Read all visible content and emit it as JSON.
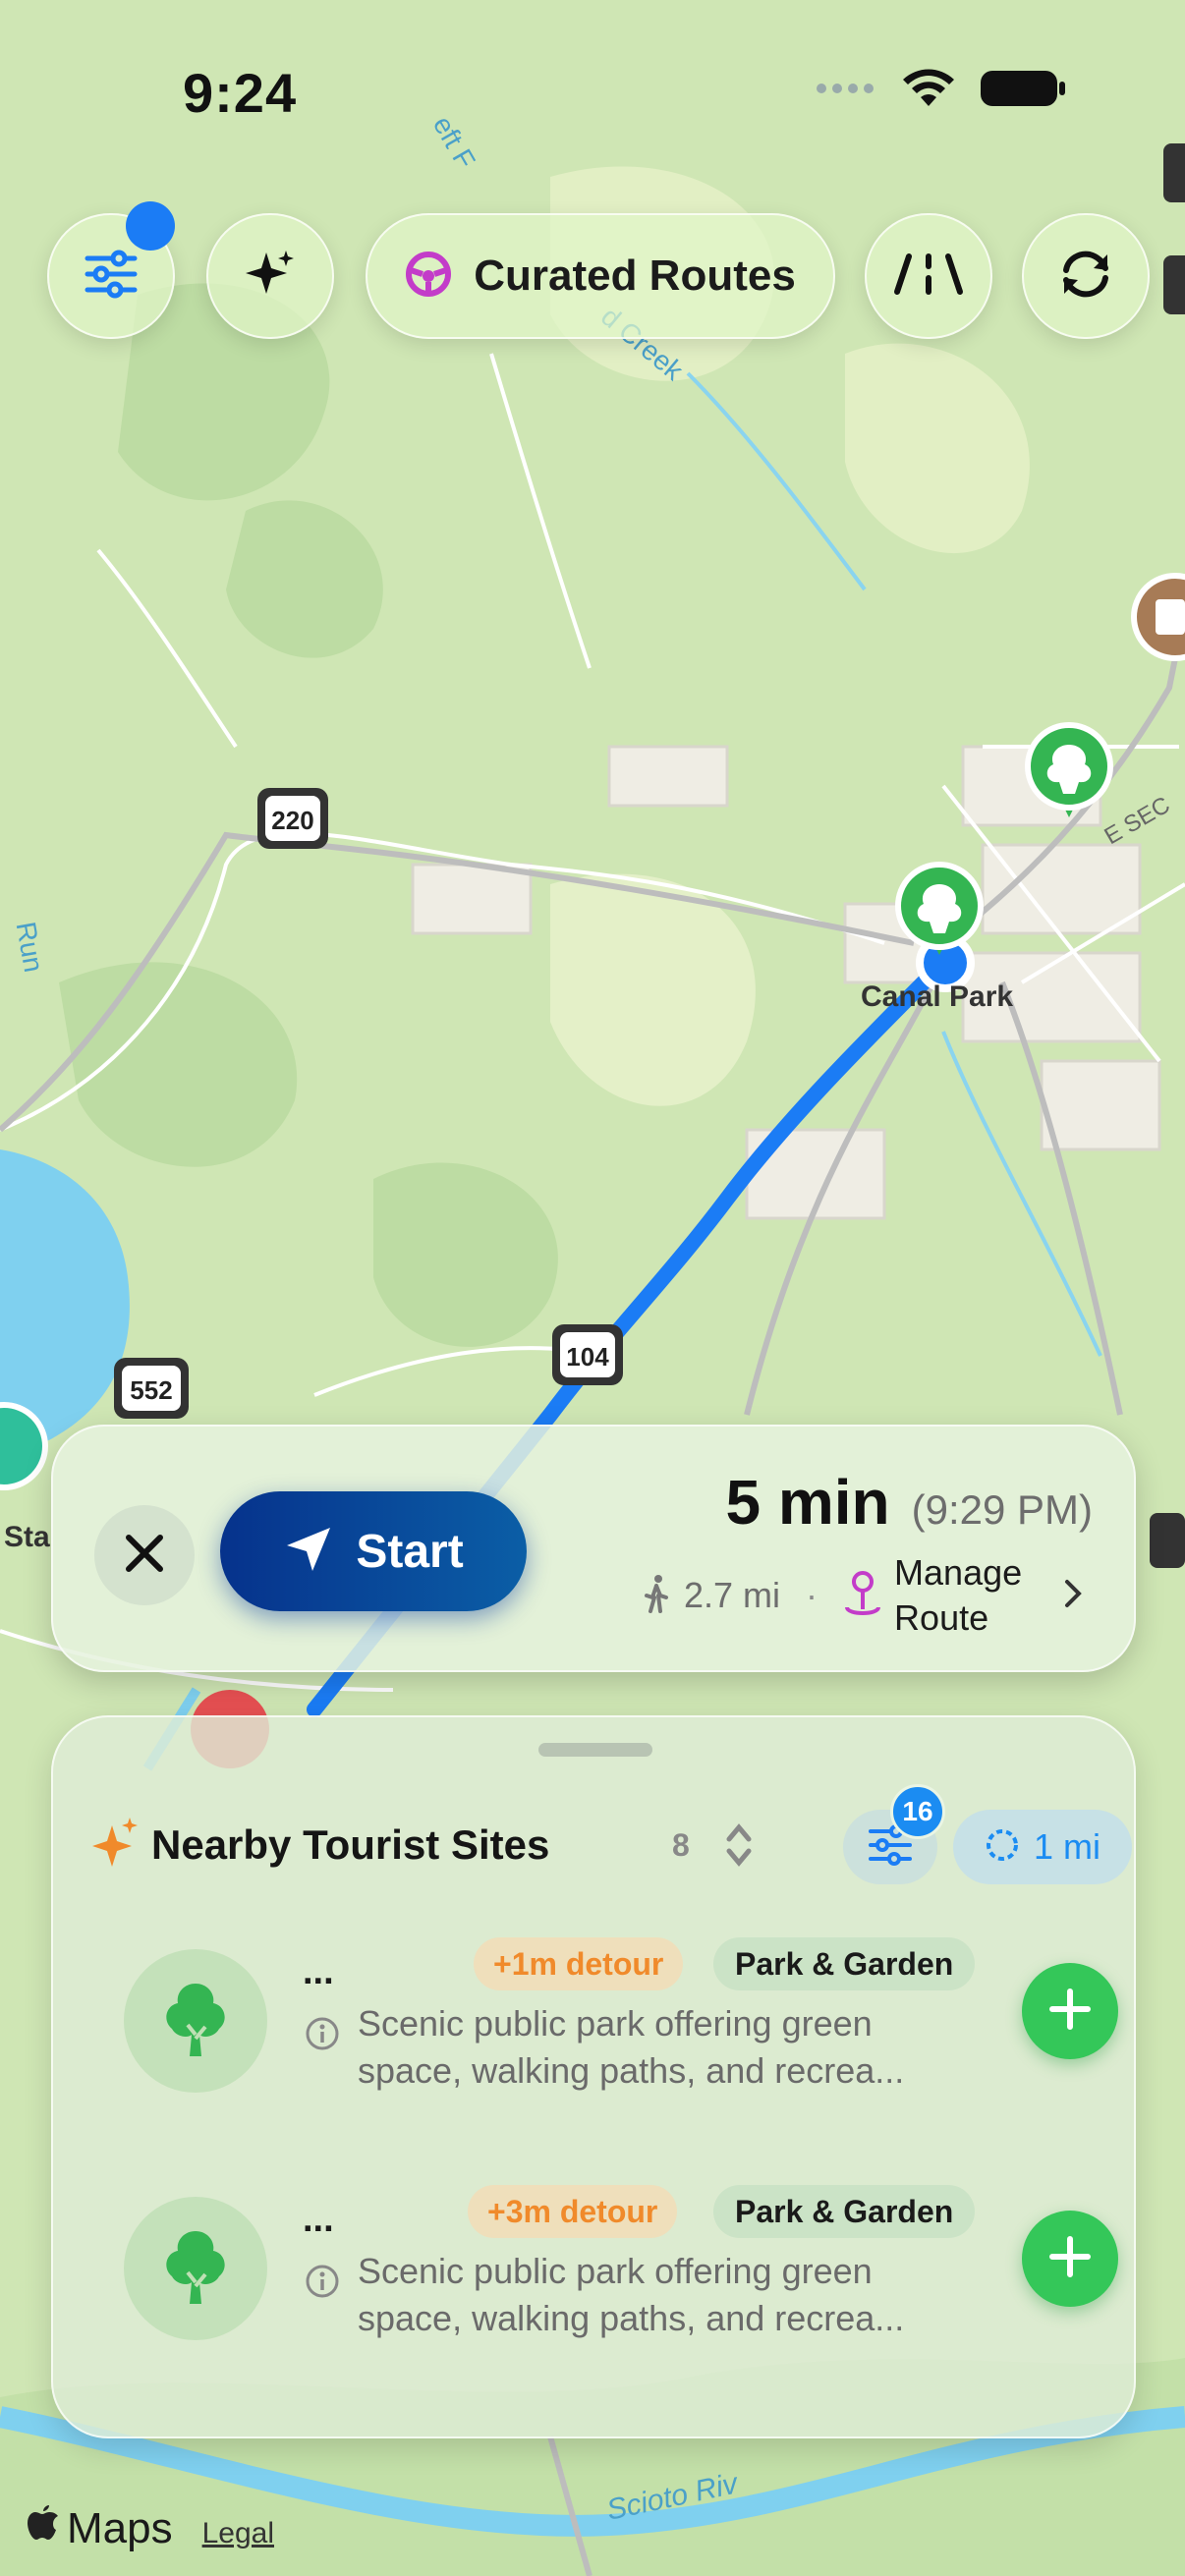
{
  "status_bar": {
    "time": "9:24"
  },
  "toolbar": {
    "curated_routes_label": "Curated Routes"
  },
  "map": {
    "labels": {
      "canal_park": "Canal Park",
      "creek": "d Creek",
      "creek_top": "eft F",
      "run": "Run",
      "road_e": "E SEC",
      "river": "Scioto Riv",
      "sta": "Sta"
    },
    "shields": [
      "220",
      "104",
      "552"
    ]
  },
  "route_card": {
    "start_label": "Start",
    "eta": "5 min",
    "arrival": "(9:29 PM)",
    "distance": "2.7 mi",
    "separator": "·",
    "manage_route": "Manage Route"
  },
  "sheet": {
    "title": "Nearby Tourist Sites",
    "count": "8",
    "filter_badge": "16",
    "radius": "1 mi",
    "items": [
      {
        "name": "...",
        "detour": "+1m detour",
        "category": "Park & Garden",
        "description": "Scenic public park offering green space, walking paths, and recrea..."
      },
      {
        "name": "...",
        "detour": "+3m detour",
        "category": "Park & Garden",
        "description": "Scenic public park offering green space, walking paths, and recrea..."
      }
    ]
  },
  "footer": {
    "brand": "Maps",
    "legal": "Legal"
  },
  "colors": {
    "route_blue": "#1b7cf5",
    "start_button": "#06328c",
    "add_green": "#34c759",
    "detour_orange": "#f08a2b",
    "accent_purple": "#c33cc9"
  }
}
